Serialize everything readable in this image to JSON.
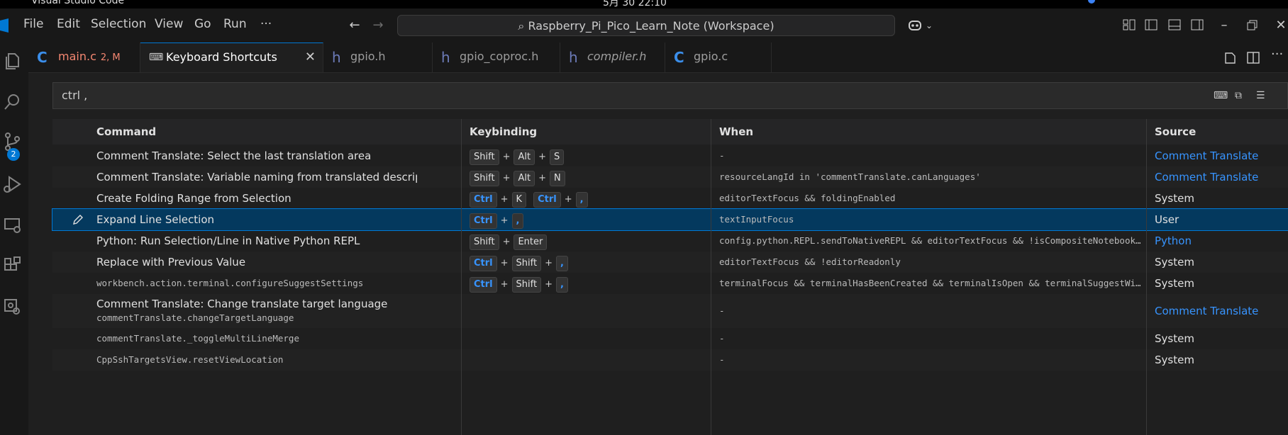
{
  "os": {
    "app_name": "Visual Studio Code",
    "clock": "5月 30 22:10"
  },
  "menu": [
    "File",
    "Edit",
    "Selection",
    "View",
    "Go",
    "Run",
    "···"
  ],
  "workspace_title": "Raspberry_Pi_Pico_Learn_Note (Workspace)",
  "tabs": [
    {
      "icon": "C",
      "name": "main.c",
      "badge": "2, M",
      "italic": false
    },
    {
      "icon": "⌨",
      "name": "Keyboard Shortcuts",
      "badge": "",
      "italic": false
    },
    {
      "icon": "h",
      "name": "gpio.h",
      "badge": "",
      "italic": false
    },
    {
      "icon": "h",
      "name": "gpio_coproc.h",
      "badge": "",
      "italic": false
    },
    {
      "icon": "h",
      "name": "compiler.h",
      "badge": "",
      "italic": true
    },
    {
      "icon": "C",
      "name": "gpio.c",
      "badge": "",
      "italic": false
    }
  ],
  "scm_badge": "2",
  "search": {
    "value": "ctrl ,"
  },
  "columns": {
    "command": "Command",
    "keybinding": "Keybinding",
    "when": "When",
    "source": "Source"
  },
  "rows": [
    {
      "command": "Comment Translate: Select the last translation area",
      "keys": [
        [
          "Shift",
          "Alt",
          "S"
        ]
      ],
      "when": "-",
      "source": "Comment Translate",
      "source_link": true
    },
    {
      "command": "Comment Translate: Variable naming from translated descriptions",
      "keys": [
        [
          "Shift",
          "Alt",
          "N"
        ]
      ],
      "when": "resourceLangId in 'commentTranslate.canLanguages'",
      "source": "Comment Translate",
      "source_link": true
    },
    {
      "command": "Create Folding Range from Selection",
      "keys": [
        [
          "Ctrl",
          "K"
        ],
        [
          "Ctrl",
          ","
        ]
      ],
      "when": "editorTextFocus && foldingEnabled",
      "source": "System",
      "source_link": false
    },
    {
      "command": "Expand Line Selection",
      "keys": [
        [
          "Ctrl",
          ","
        ]
      ],
      "when": "textInputFocus",
      "source": "User",
      "source_link": false,
      "selected": true
    },
    {
      "command": "Python: Run Selection/Line in Native Python REPL",
      "keys": [
        [
          "Shift",
          "Enter"
        ]
      ],
      "when": "config.python.REPL.sendToNativeREPL && editorTextFocus && !isCompositeNotebook &&…",
      "source": "Python",
      "source_link": true
    },
    {
      "command": "Replace with Previous Value",
      "keys": [
        [
          "Ctrl",
          "Shift",
          ","
        ]
      ],
      "when": "editorTextFocus && !editorReadonly",
      "source": "System",
      "source_link": false
    },
    {
      "command": "workbench.action.terminal.configureSuggestSettings",
      "command_mono": true,
      "keys": [
        [
          "Ctrl",
          "Shift",
          ","
        ]
      ],
      "when": "terminalFocus && terminalHasBeenCreated && terminalIsOpen && terminalSuggestWidge…",
      "source": "System",
      "source_link": false
    },
    {
      "command": "Comment Translate: Change translate target language",
      "command_sub": "commentTranslate.changeTargetLanguage",
      "keys": [],
      "when": "-",
      "source": "Comment Translate",
      "source_link": true,
      "tall": true
    },
    {
      "command": "commentTranslate._toggleMultiLineMerge",
      "command_mono": true,
      "keys": [],
      "when": "-",
      "source": "System",
      "source_link": false
    },
    {
      "command": "CppSshTargetsView.resetViewLocation",
      "command_mono": true,
      "keys": [],
      "when": "-",
      "source": "System",
      "source_link": false
    }
  ]
}
